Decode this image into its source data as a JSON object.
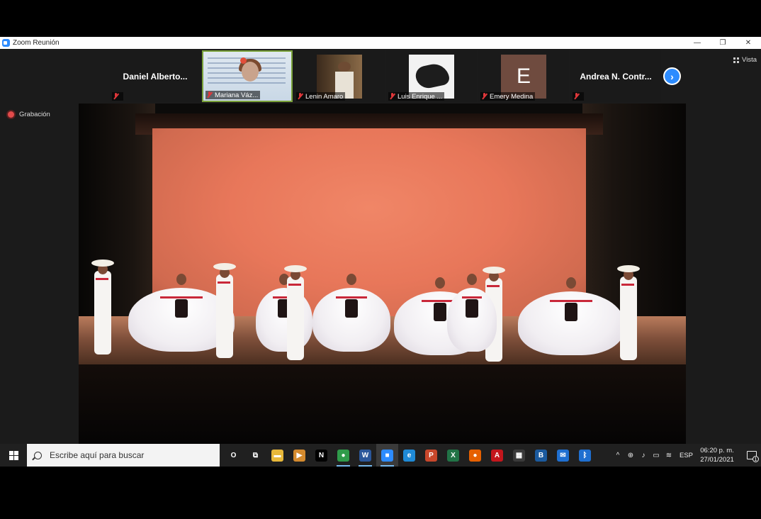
{
  "window": {
    "title": "Zoom Reunión",
    "controls": {
      "minimize": "—",
      "restore": "❐",
      "close": "✕"
    }
  },
  "zoom": {
    "view_label": "Vista",
    "recording_label": "Grabación",
    "next_icon": "chevron-right-icon",
    "participants": [
      {
        "name": "Daniel Alberto...",
        "type": "name",
        "muted": true
      },
      {
        "name": "Mariana Váz...",
        "type": "video",
        "muted": true,
        "active": true
      },
      {
        "name": "Lenin Amaro",
        "type": "video",
        "muted": true
      },
      {
        "name": "Luis Enrique ...",
        "type": "video",
        "muted": true
      },
      {
        "name": "Emery Medina",
        "type": "avatar",
        "avatar_letter": "E",
        "muted": true
      },
      {
        "name": "Andrea N. Contr...",
        "type": "name",
        "muted": true
      }
    ]
  },
  "taskbar": {
    "search_placeholder": "Escribe aquí para buscar",
    "apps": [
      {
        "icon": "cortana-icon",
        "glyph": "O",
        "color": "#202020"
      },
      {
        "icon": "task-view-icon",
        "glyph": "⧉",
        "color": "#202020"
      },
      {
        "icon": "file-explorer-icon",
        "glyph": "▬",
        "color": "#e8b83a"
      },
      {
        "icon": "media-player-icon",
        "glyph": "▶",
        "color": "#d48a2e"
      },
      {
        "icon": "netflix-icon",
        "glyph": "N",
        "color": "#000000"
      },
      {
        "icon": "chrome-icon",
        "glyph": "●",
        "color": "#2f9b4a"
      },
      {
        "icon": "word-icon",
        "glyph": "W",
        "color": "#2b579a"
      },
      {
        "icon": "zoom-icon",
        "glyph": "■",
        "color": "#2d8cff"
      },
      {
        "icon": "edge-icon",
        "glyph": "e",
        "color": "#1f8ad6"
      },
      {
        "icon": "powerpoint-icon",
        "glyph": "P",
        "color": "#c8472b"
      },
      {
        "icon": "excel-icon",
        "glyph": "X",
        "color": "#217346"
      },
      {
        "icon": "firefox-icon",
        "glyph": "●",
        "color": "#e66000"
      },
      {
        "icon": "acrobat-icon",
        "glyph": "A",
        "color": "#c4161c"
      },
      {
        "icon": "store-icon",
        "glyph": "▦",
        "color": "#3a3a3a"
      },
      {
        "icon": "b-app-icon",
        "glyph": "B",
        "color": "#1b5a9e"
      },
      {
        "icon": "mail-icon",
        "glyph": "✉",
        "color": "#1f6fd0"
      },
      {
        "icon": "bluetooth-icon",
        "glyph": "ᛒ",
        "color": "#1f6fd0"
      }
    ],
    "tray": {
      "icons": [
        "^",
        "⊕",
        "♪",
        "▭",
        "≋"
      ],
      "language": "ESP",
      "time": "06:20 p. m.",
      "date": "27/01/2021",
      "notification_count": "1"
    }
  }
}
